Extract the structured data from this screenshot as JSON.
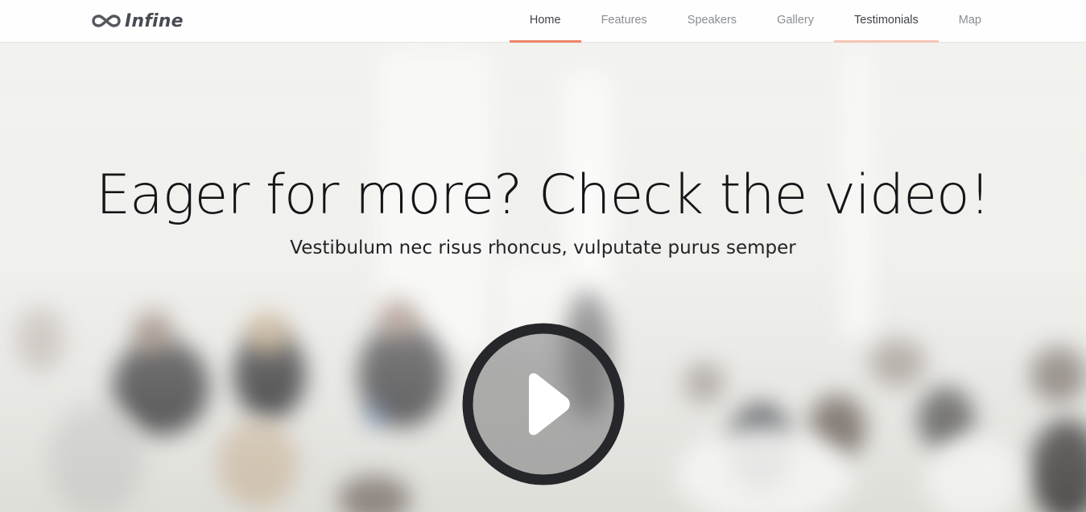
{
  "header": {
    "logo_text": "Infine",
    "logo_icon": "infinity-icon",
    "nav": [
      {
        "label": "Home",
        "state": "active"
      },
      {
        "label": "Features",
        "state": ""
      },
      {
        "label": "Speakers",
        "state": ""
      },
      {
        "label": "Gallery",
        "state": ""
      },
      {
        "label": "Testimonials",
        "state": "hover"
      },
      {
        "label": "Map",
        "state": ""
      }
    ]
  },
  "hero": {
    "headline": "Eager for more? Check the video!",
    "subline": "Vestibulum nec risus rhoncus, vulputate purus semper",
    "play_icon": "play-icon"
  },
  "colors": {
    "accent": "#ec8468",
    "accent_light": "#f6c3b4",
    "text_dark": "#141517",
    "nav_text": "#8a8d92",
    "play_ring": "#2a2b2e"
  }
}
